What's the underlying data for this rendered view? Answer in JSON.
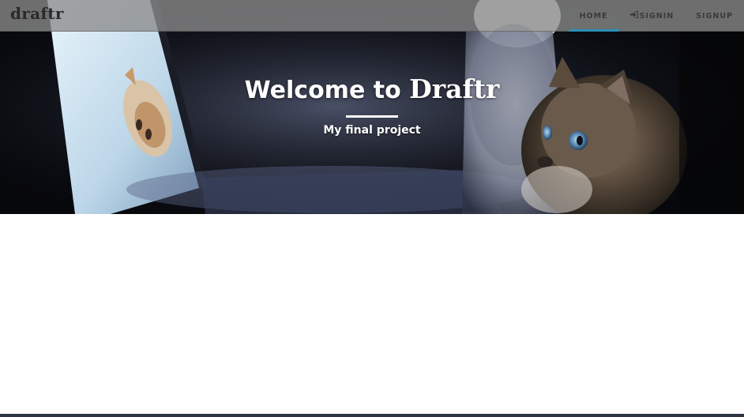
{
  "navbar": {
    "brand": "draftr",
    "links": [
      {
        "label": "HOME",
        "active": true
      },
      {
        "label": "SIGNIN",
        "icon": "sign-in-icon"
      },
      {
        "label": "SIGNUP"
      }
    ]
  },
  "hero": {
    "title_prefix": "Welcome to",
    "title_brand": "Draftr",
    "subtitle": "My final project",
    "image": "cats-looking-at-laptop-photo"
  },
  "colors": {
    "navbar_bg": "#8c8c8c",
    "active_underline": "#2a8fb5",
    "hero_text": "#ffffff",
    "nav_text": "#3a3a3a",
    "bottom_strip": "#2c3440"
  }
}
